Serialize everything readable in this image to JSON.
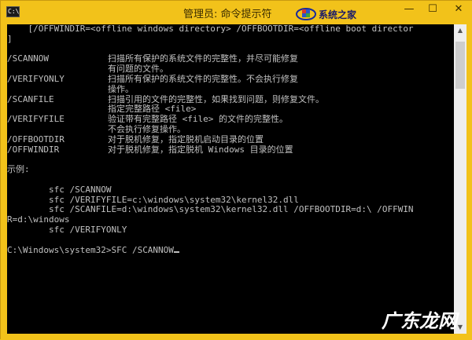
{
  "window": {
    "title": "管理员: 命令提示符",
    "app_icon_text": "C:\\",
    "controls": {
      "minimize": "—",
      "maximize": "☐",
      "close": "✕"
    }
  },
  "watermark_site": {
    "name": "系统之家"
  },
  "watermark": "广东龙网",
  "console": {
    "line0": "    [/OFFWINDIR=<offline windows directory> /OFFBOOTDIR=<offline boot director",
    "line1": "]",
    "options": [
      {
        "flag": "/SCANNOW",
        "desc": "扫描所有保护的系统文件的完整性，并尽可能修复"
      },
      {
        "flag": "",
        "desc": "有问题的文件。"
      },
      {
        "flag": "/VERIFYONLY",
        "desc": "扫描所有保护的系统文件的完整性。不会执行修复"
      },
      {
        "flag": "",
        "desc": "操作。"
      },
      {
        "flag": "/SCANFILE",
        "desc": "扫描引用的文件的完整性，如果找到问题，则修复文件。"
      },
      {
        "flag": "",
        "desc": "指定完整路径 <file>"
      },
      {
        "flag": "/VERIFYFILE",
        "desc": "验证带有完整路径 <file> 的文件的完整性。"
      },
      {
        "flag": "",
        "desc": "不会执行修复操作。"
      },
      {
        "flag": "/OFFBOOTDIR",
        "desc": "对于脱机修复，指定脱机启动目录的位置"
      },
      {
        "flag": "/OFFWINDIR",
        "desc": "对于脱机修复，指定脱机 Windows 目录的位置"
      }
    ],
    "example_header": "示例:",
    "examples": [
      "        sfc /SCANNOW",
      "        sfc /VERIFYFILE=c:\\windows\\system32\\kernel32.dll",
      "        sfc /SCANFILE=d:\\windows\\system32\\kernel32.dll /OFFBOOTDIR=d:\\ /OFFWIN",
      "R=d:\\windows",
      "        sfc /VERIFYONLY"
    ],
    "prompt": "C:\\Windows\\system32>",
    "command": "SFC /SCANNOW"
  },
  "colors": {
    "frame": "#f2c21a",
    "console_bg": "#000000",
    "console_text": "#c0c0c0"
  }
}
